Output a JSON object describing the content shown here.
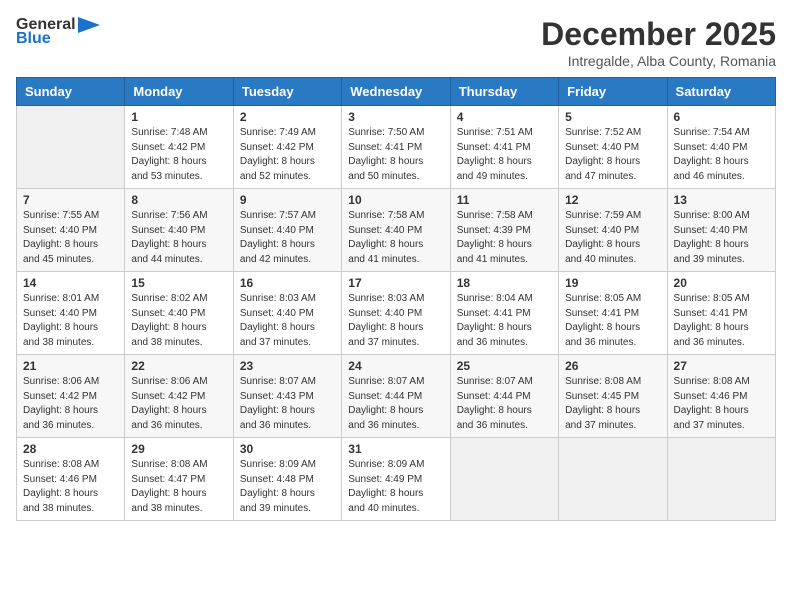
{
  "logo": {
    "line1": "General",
    "line2": "Blue"
  },
  "title": "December 2025",
  "subtitle": "Intregalde, Alba County, Romania",
  "days_of_week": [
    "Sunday",
    "Monday",
    "Tuesday",
    "Wednesday",
    "Thursday",
    "Friday",
    "Saturday"
  ],
  "weeks": [
    [
      {
        "day": "",
        "info": ""
      },
      {
        "day": "1",
        "info": "Sunrise: 7:48 AM\nSunset: 4:42 PM\nDaylight: 8 hours\nand 53 minutes."
      },
      {
        "day": "2",
        "info": "Sunrise: 7:49 AM\nSunset: 4:42 PM\nDaylight: 8 hours\nand 52 minutes."
      },
      {
        "day": "3",
        "info": "Sunrise: 7:50 AM\nSunset: 4:41 PM\nDaylight: 8 hours\nand 50 minutes."
      },
      {
        "day": "4",
        "info": "Sunrise: 7:51 AM\nSunset: 4:41 PM\nDaylight: 8 hours\nand 49 minutes."
      },
      {
        "day": "5",
        "info": "Sunrise: 7:52 AM\nSunset: 4:40 PM\nDaylight: 8 hours\nand 47 minutes."
      },
      {
        "day": "6",
        "info": "Sunrise: 7:54 AM\nSunset: 4:40 PM\nDaylight: 8 hours\nand 46 minutes."
      }
    ],
    [
      {
        "day": "7",
        "info": "Sunrise: 7:55 AM\nSunset: 4:40 PM\nDaylight: 8 hours\nand 45 minutes."
      },
      {
        "day": "8",
        "info": "Sunrise: 7:56 AM\nSunset: 4:40 PM\nDaylight: 8 hours\nand 44 minutes."
      },
      {
        "day": "9",
        "info": "Sunrise: 7:57 AM\nSunset: 4:40 PM\nDaylight: 8 hours\nand 42 minutes."
      },
      {
        "day": "10",
        "info": "Sunrise: 7:58 AM\nSunset: 4:40 PM\nDaylight: 8 hours\nand 41 minutes."
      },
      {
        "day": "11",
        "info": "Sunrise: 7:58 AM\nSunset: 4:39 PM\nDaylight: 8 hours\nand 41 minutes."
      },
      {
        "day": "12",
        "info": "Sunrise: 7:59 AM\nSunset: 4:40 PM\nDaylight: 8 hours\nand 40 minutes."
      },
      {
        "day": "13",
        "info": "Sunrise: 8:00 AM\nSunset: 4:40 PM\nDaylight: 8 hours\nand 39 minutes."
      }
    ],
    [
      {
        "day": "14",
        "info": "Sunrise: 8:01 AM\nSunset: 4:40 PM\nDaylight: 8 hours\nand 38 minutes."
      },
      {
        "day": "15",
        "info": "Sunrise: 8:02 AM\nSunset: 4:40 PM\nDaylight: 8 hours\nand 38 minutes."
      },
      {
        "day": "16",
        "info": "Sunrise: 8:03 AM\nSunset: 4:40 PM\nDaylight: 8 hours\nand 37 minutes."
      },
      {
        "day": "17",
        "info": "Sunrise: 8:03 AM\nSunset: 4:40 PM\nDaylight: 8 hours\nand 37 minutes."
      },
      {
        "day": "18",
        "info": "Sunrise: 8:04 AM\nSunset: 4:41 PM\nDaylight: 8 hours\nand 36 minutes."
      },
      {
        "day": "19",
        "info": "Sunrise: 8:05 AM\nSunset: 4:41 PM\nDaylight: 8 hours\nand 36 minutes."
      },
      {
        "day": "20",
        "info": "Sunrise: 8:05 AM\nSunset: 4:41 PM\nDaylight: 8 hours\nand 36 minutes."
      }
    ],
    [
      {
        "day": "21",
        "info": "Sunrise: 8:06 AM\nSunset: 4:42 PM\nDaylight: 8 hours\nand 36 minutes."
      },
      {
        "day": "22",
        "info": "Sunrise: 8:06 AM\nSunset: 4:42 PM\nDaylight: 8 hours\nand 36 minutes."
      },
      {
        "day": "23",
        "info": "Sunrise: 8:07 AM\nSunset: 4:43 PM\nDaylight: 8 hours\nand 36 minutes."
      },
      {
        "day": "24",
        "info": "Sunrise: 8:07 AM\nSunset: 4:44 PM\nDaylight: 8 hours\nand 36 minutes."
      },
      {
        "day": "25",
        "info": "Sunrise: 8:07 AM\nSunset: 4:44 PM\nDaylight: 8 hours\nand 36 minutes."
      },
      {
        "day": "26",
        "info": "Sunrise: 8:08 AM\nSunset: 4:45 PM\nDaylight: 8 hours\nand 37 minutes."
      },
      {
        "day": "27",
        "info": "Sunrise: 8:08 AM\nSunset: 4:46 PM\nDaylight: 8 hours\nand 37 minutes."
      }
    ],
    [
      {
        "day": "28",
        "info": "Sunrise: 8:08 AM\nSunset: 4:46 PM\nDaylight: 8 hours\nand 38 minutes."
      },
      {
        "day": "29",
        "info": "Sunrise: 8:08 AM\nSunset: 4:47 PM\nDaylight: 8 hours\nand 38 minutes."
      },
      {
        "day": "30",
        "info": "Sunrise: 8:09 AM\nSunset: 4:48 PM\nDaylight: 8 hours\nand 39 minutes."
      },
      {
        "day": "31",
        "info": "Sunrise: 8:09 AM\nSunset: 4:49 PM\nDaylight: 8 hours\nand 40 minutes."
      },
      {
        "day": "",
        "info": ""
      },
      {
        "day": "",
        "info": ""
      },
      {
        "day": "",
        "info": ""
      }
    ]
  ]
}
